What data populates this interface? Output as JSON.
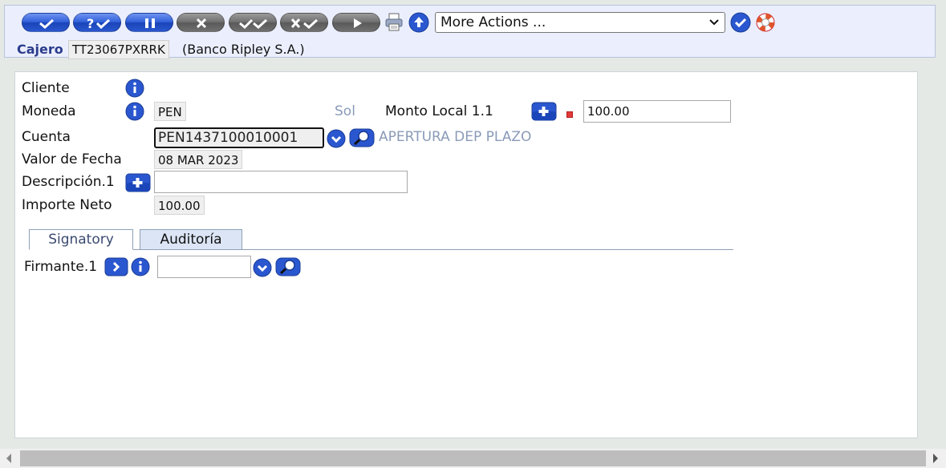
{
  "toolbar": {
    "buttons": [
      {
        "name": "commit",
        "icon": "check-icon",
        "color": "blue"
      },
      {
        "name": "validate",
        "icon": "question-check-icon",
        "color": "blue"
      },
      {
        "name": "hold",
        "icon": "pause-icon",
        "color": "blue"
      },
      {
        "name": "delete",
        "icon": "x-icon",
        "color": "grey"
      },
      {
        "name": "authorise",
        "icon": "double-check-icon",
        "color": "grey"
      },
      {
        "name": "reverse",
        "icon": "x-check-icon",
        "color": "grey"
      },
      {
        "name": "next",
        "icon": "play-icon",
        "color": "grey"
      }
    ],
    "print_icon": "printer-icon",
    "upload_icon": "upload-icon",
    "more_actions": "More Actions ...",
    "go_icon": "check-icon",
    "help_icon": "lifebuoy-icon"
  },
  "cajero": {
    "label": "Cajero",
    "id": "TT23067PXRRK",
    "bank": "(Banco Ripley S.A.)"
  },
  "form": {
    "cliente_label": "Cliente",
    "moneda_label": "Moneda",
    "moneda_value": "PEN",
    "moneda_desc": "Sol",
    "monto_label": "Monto Local 1.1",
    "monto_value": "100.00",
    "cuenta_label": "Cuenta",
    "cuenta_value": "PEN1437100010001",
    "cuenta_desc": "APERTURA DEP PLAZO",
    "fecha_label": "Valor de Fecha",
    "fecha_value": "08 MAR 2023",
    "descripcion_label": "Descripción.1",
    "descripcion_value": "",
    "importe_label": "Importe Neto",
    "importe_value": "100.00"
  },
  "tabs": [
    {
      "label": "Signatory",
      "active": true
    },
    {
      "label": "Auditoría",
      "active": false
    }
  ],
  "signatory": {
    "firmante_label": "Firmante.1",
    "firmante_value": ""
  },
  "colors": {
    "accent_blue": "#2f5fd9",
    "toolbar_bg": "#ebeffd",
    "label_navy": "#2c3d8c",
    "desc_grey_blue": "#8a9bb8",
    "page_bg": "#e4e9e6"
  }
}
